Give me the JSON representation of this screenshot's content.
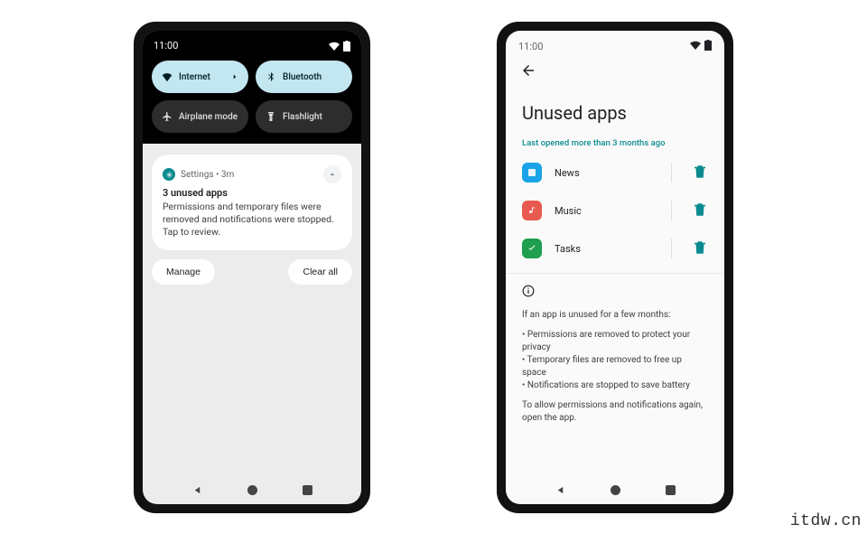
{
  "watermark": "itdw.cn",
  "status": {
    "time": "11:00"
  },
  "qs": {
    "internet": "Internet",
    "bluetooth": "Bluetooth",
    "airplane": "Airplane mode",
    "flashlight": "Flashlight"
  },
  "notification": {
    "app_label": "Settings • 3m",
    "title": "3 unused apps",
    "body": "Permissions and temporary files were removed and notifications were stopped. Tap to review.",
    "manage": "Manage",
    "clear": "Clear all"
  },
  "unused": {
    "title": "Unused apps",
    "section_label": "Last opened more than 3 months ago",
    "apps": {
      "news": "News",
      "music": "Music",
      "tasks": "Tasks"
    },
    "info": {
      "intro": "If an app is unused for a few months:",
      "b1": "Permissions are removed to protect your privacy",
      "b2": "Temporary files are removed to free up space",
      "b3": "Notifications are stopped to save battery",
      "outro": "To allow permissions and notifications again, open the app."
    }
  }
}
